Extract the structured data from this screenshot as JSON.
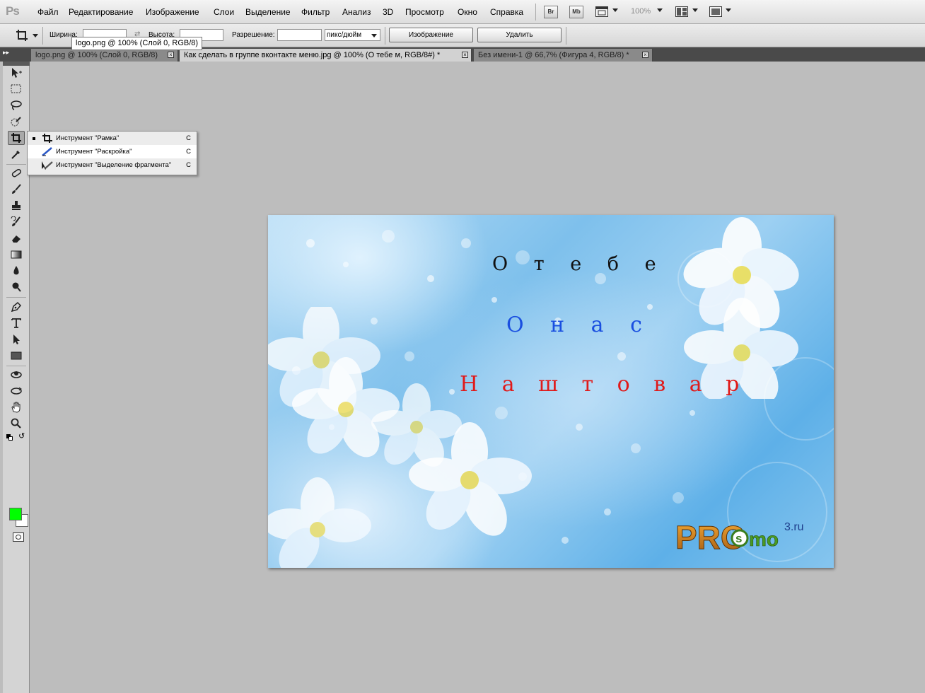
{
  "app": {
    "logo": "Ps"
  },
  "menubar": {
    "items": [
      "Файл",
      "Редактирование",
      "Изображение",
      "Слои",
      "Выделение",
      "Фильтр",
      "Анализ",
      "3D",
      "Просмотр",
      "Окно",
      "Справка"
    ],
    "bridge_label": "Br",
    "minibridge_label": "Mb",
    "zoom": "100%"
  },
  "options": {
    "width_label": "Ширина:",
    "height_label": "Высота:",
    "resolution_label": "Разрешение:",
    "unit": "пикс/дюйм",
    "image_button": "Изображение",
    "delete_button": "Удалить",
    "tooltip": "logo.png @ 100% (Слой 0, RGB/8)"
  },
  "tabs": [
    {
      "label": "logo.png @ 100% (Слой 0, RGB/8)",
      "active": false
    },
    {
      "label": "Как сделать в группе вконтакте меню.jpg @ 100% (О тебе м, RGB/8#) *",
      "active": true
    },
    {
      "label": "Без имени-1 @ 66,7% (Фигура 4, RGB/8) *",
      "active": false
    }
  ],
  "flyout": {
    "items": [
      {
        "label": "Инструмент \"Рамка\"",
        "shortcut": "C",
        "icon": "crop-icon"
      },
      {
        "label": "Инструмент \"Раскройка\"",
        "shortcut": "C",
        "icon": "slice-icon"
      },
      {
        "label": "Инструмент \"Выделение фрагмента\"",
        "shortcut": "C",
        "icon": "slice-select-icon"
      }
    ]
  },
  "colors": {
    "foreground": "#00ff00",
    "background": "#ffffff"
  },
  "canvas": {
    "menu_lines": [
      {
        "text": "О  т е б е",
        "color": "#111111"
      },
      {
        "text": "О н а с",
        "color": "#1a4fe0"
      },
      {
        "text": "Н а ш  т о в а р",
        "color": "#e01a1a"
      }
    ],
    "logo": {
      "main": "PRO",
      "circle": "s",
      "tail": "mo",
      "sup": "3.ru"
    }
  }
}
